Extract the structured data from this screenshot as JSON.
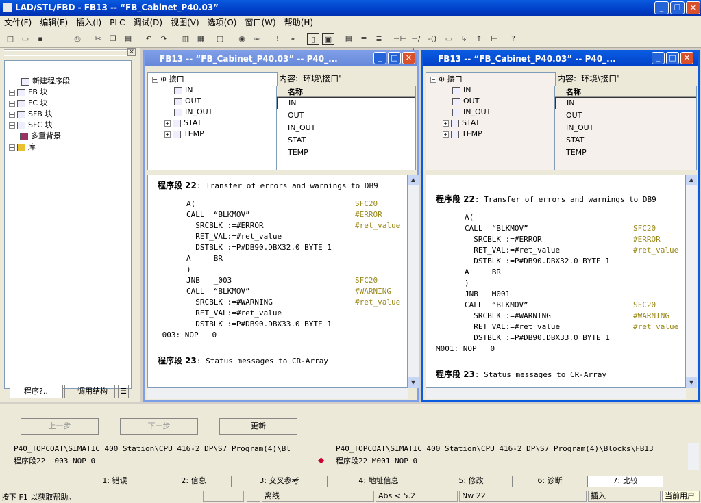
{
  "app": {
    "title": "LAD/STL/FBD  - FB13 -- “FB_Cabinet_P40.03”"
  },
  "menu": [
    "文件(F)",
    "编辑(E)",
    "插入(I)",
    "PLC",
    "调试(D)",
    "视图(V)",
    "选项(O)",
    "窗口(W)",
    "帮助(H)"
  ],
  "left_tree": {
    "items": [
      "新建程序段",
      "FB 块",
      "FC 块",
      "SFB 块",
      "SFC 块",
      "多重背景",
      "库"
    ],
    "tab1": "程序?..",
    "tab2": "调用结构"
  },
  "window_left": {
    "title": "FB13 -- “FB_Cabinet_P40.03” -- P40_...",
    "iface_root": "接口",
    "iface": [
      "IN",
      "OUT",
      "IN_OUT",
      "STAT",
      "TEMP"
    ],
    "content_label": "内容: '环境\\接口'",
    "col_name": "名称",
    "list": [
      "IN",
      "OUT",
      "IN_OUT",
      "STAT",
      "TEMP"
    ],
    "net22_head": "程序段 22",
    "net22_desc": ": Transfer of errors and warnings to DB9",
    "code": [
      "A(",
      "CALL  “BLKMOV”",
      "  SRCBLK :=#ERROR",
      "  RET_VAL:=#ret_value",
      "  DSTBLK :=P#DB90.DBX32.0 BYTE 1",
      "A     BR",
      ")",
      "JNB   _003",
      "CALL  “BLKMOV”",
      "  SRCBLK :=#WARNING",
      "  RET_VAL:=#ret_value",
      "  DSTBLK :=P#DB90.DBX33.0 BYTE 1"
    ],
    "cmt": [
      "",
      "SFC20",
      "#ERROR",
      "#ret_value",
      "",
      "",
      "",
      "",
      "SFC20",
      "#WARNING",
      "#ret_value",
      ""
    ],
    "last": "_003: NOP   0",
    "net23_head": "程序段 23",
    "net23_desc": ": Status messages to CR-Array"
  },
  "window_right": {
    "title": "FB13 -- “FB_Cabinet_P40.03” -- P40_...",
    "iface_root": "接口",
    "iface": [
      "IN",
      "OUT",
      "IN_OUT",
      "STAT",
      "TEMP"
    ],
    "content_label": "内容: '环境\\接口'",
    "col_name": "名称",
    "list": [
      "IN",
      "OUT",
      "IN_OUT",
      "STAT",
      "TEMP"
    ],
    "net22_head": "程序段 22",
    "net22_desc": ": Transfer of errors and warnings to DB9",
    "code": [
      "A(",
      "CALL  “BLKMOV”",
      "  SRCBLK :=#ERROR",
      "  RET_VAL:=#ret_value",
      "  DSTBLK :=P#DB90.DBX32.0 BYTE 1",
      "A     BR",
      ")",
      "JNB   M001",
      "CALL  “BLKMOV”",
      "  SRCBLK :=#WARNING",
      "  RET_VAL:=#ret_value",
      "  DSTBLK :=P#DB90.DBX33.0 BYTE 1"
    ],
    "cmt": [
      "",
      "SFC20",
      "#ERROR",
      "#ret_value",
      "",
      "",
      "",
      "",
      "SFC20",
      "#WARNING",
      "#ret_value",
      ""
    ],
    "last": "M001: NOP   0",
    "net23_head": "程序段 23",
    "net23_desc": ": Status messages to CR-Array"
  },
  "compare": {
    "prev": "上一步",
    "next": "下一步",
    "update": "更新",
    "path_left": "P40_TOPCOAT\\SIMATIC 400 Station\\CPU 416-2 DP\\S7 Program(4)\\Bl",
    "path_right": "P40_TOPCOAT\\SIMATIC 400 Station\\CPU 416-2 DP\\S7 Program(4)\\Blocks\\FB13",
    "row_left": "程序段22  _003  NOP   0",
    "row_right": "程序段22  M001  NOP   0"
  },
  "tabs": [
    "1: 错误",
    "2: 信息",
    "3: 交叉参考",
    "4: 地址信息",
    "5: 修改",
    "6: 诊断",
    "7: 比较"
  ],
  "status": {
    "help": "按下 F1 以获取帮助。",
    "offline": "离线",
    "abs": "Abs < 5.2",
    "nw": "Nw 22",
    "insert": "插入",
    "user": "当前用户"
  },
  "colors": {
    "title": "#0a5be0",
    "comment": "#9a8a1c"
  }
}
